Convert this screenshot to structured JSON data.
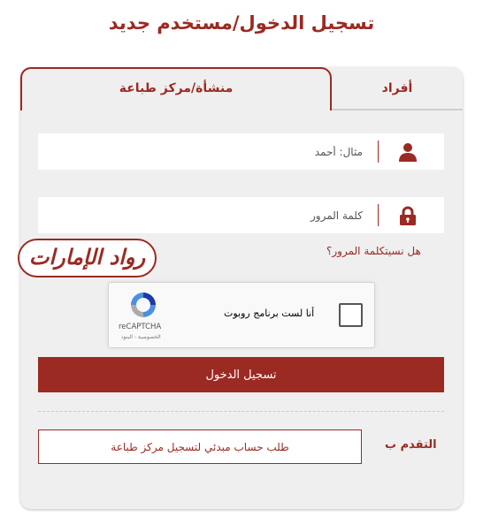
{
  "page": {
    "title": "تسجيل الدخول/مستخدم جديد"
  },
  "tabs": [
    {
      "label": "منشأة/مركز طباعة",
      "active": true
    },
    {
      "label": "أفراد",
      "active": false
    }
  ],
  "form": {
    "username_placeholder": "مثال: أحمد",
    "password_placeholder": "كلمة المرور",
    "forgot_password": "هل نسيتكلمة المرور؟",
    "login_button": "تسجيل الدخول"
  },
  "captcha": {
    "label": "أنا لست برنامج روبوت",
    "brand": "reCAPTCHA",
    "terms": "الخصوصية - البنود"
  },
  "apply": {
    "label": "التقدم ب",
    "request_button": "طلب حساب مبدئي لتسجيل مركز طباعة"
  },
  "watermark": {
    "text": "رواد الإمارات"
  },
  "icons": {
    "user": "user-icon",
    "lock": "lock-icon",
    "recaptcha": "recaptcha-logo-icon"
  },
  "colors": {
    "brand": "#9b2a22",
    "panel": "#efefef"
  }
}
